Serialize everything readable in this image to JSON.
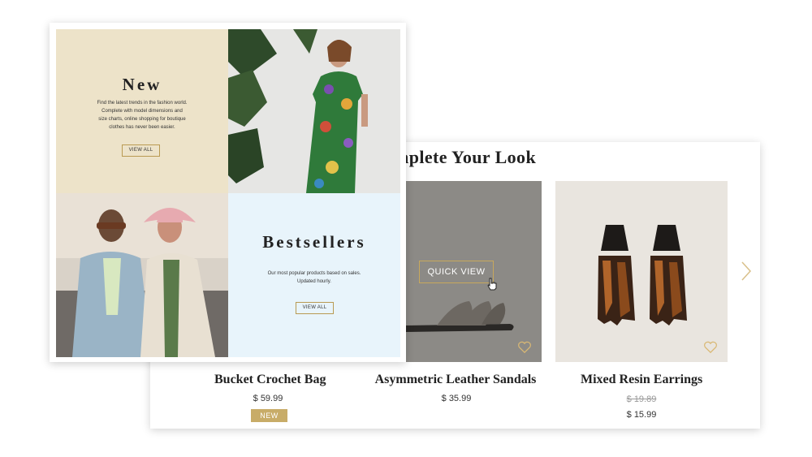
{
  "colors": {
    "gold_accent": "#c8a85c",
    "badge_bg": "#c8ac68",
    "new_tile_bg": "#ede3c9",
    "bestsellers_tile_bg": "#e8f4fb",
    "sandal_bg": "#8c8a86"
  },
  "grid": {
    "new": {
      "title": "New",
      "description": "Find the latest trends in the fashion world. Complete with model dimensions and size charts, online shopping for boutique clothes has never been easier.",
      "button": "VIEW ALL"
    },
    "bestsellers": {
      "title": "Bestsellers",
      "description": "Our most popular products based on sales. Updated hourly.",
      "button": "VIEW ALL"
    }
  },
  "look": {
    "title": "mplete Your Look",
    "quick_view": "QUICK VIEW",
    "products": [
      {
        "name": "Bucket Crochet Bag",
        "price": "$ 59.99",
        "badge": "NEW"
      },
      {
        "name": "Asymmetric Leather Sandals",
        "price": "$ 35.99"
      },
      {
        "name": "Mixed Resin Earrings",
        "old_price": "$ 19.89",
        "price": "$ 15.99"
      }
    ]
  },
  "icons": [
    "heart-icon",
    "cursor-icon",
    "chevron-right-icon"
  ]
}
